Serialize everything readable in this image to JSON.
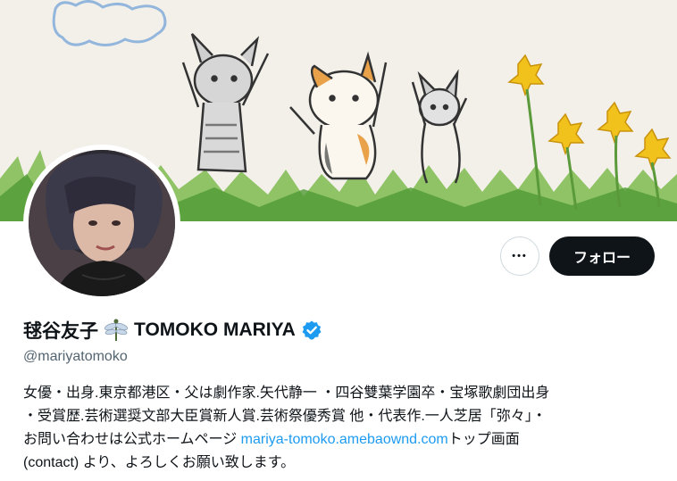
{
  "profile": {
    "name": "毬谷友子",
    "name_emoji": "dragonfly-icon",
    "name_latin": "TOMOKO MARIYA",
    "verified_badge": "verified-badge-icon",
    "handle": "@mariyatomoko",
    "bio_line1": "女優・出身.東京都港区・父は劇作家.矢代静一 ・四谷雙葉学園卒・宝塚歌劇団出身",
    "bio_line2": "・受賞歴.芸術選奨文部大臣賞新人賞.芸術祭優秀賞 他・代表作.一人芝居「弥々」・",
    "bio_line3_pre": "お問い合わせは公式ホームページ ",
    "bio_link": "mariya-tomoko.amebaownd.com",
    "bio_line3_post": "トップ画面",
    "bio_line4": "(contact) より、よろしくお願い致します。"
  },
  "actions": {
    "more_label": "•••",
    "follow_label": "フォロー"
  },
  "colors": {
    "link": "#1d9bf0",
    "verified": "#1d9bf0",
    "follow_bg": "#0f1419",
    "secondary_text": "#536471"
  }
}
